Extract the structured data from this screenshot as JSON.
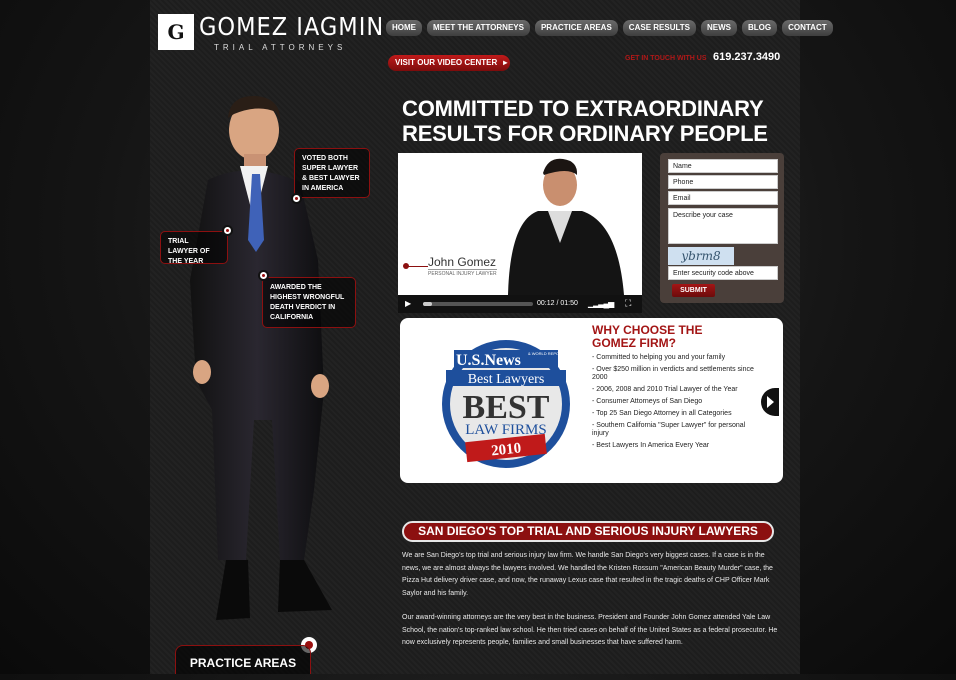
{
  "logo": {
    "mark": "G",
    "name": "GOMEZ IAGMIN",
    "tagline": "TRIAL ATTORNEYS"
  },
  "nav": [
    "HOME",
    "MEET THE ATTORNEYS",
    "PRACTICE AREAS",
    "CASE RESULTS",
    "NEWS",
    "BLOG",
    "CONTACT"
  ],
  "video_center": "VISIT OUR VIDEO CENTER",
  "get_in_touch": "GET IN TOUCH WITH US",
  "phone": "619.237.3490",
  "callouts": {
    "c1": "VOTED BOTH SUPER LAWYER & BEST LAWYER IN AMERICA",
    "c2": "TRIAL LAWYER OF THE YEAR",
    "c3": "AWARDED THE HIGHEST WRONGFUL DEATH VERDICT IN CALIFORNIA"
  },
  "headline": {
    "line1": "COMMITTED TO EXTRAORDINARY",
    "line2": "RESULTS FOR ORDINARY PEOPLE"
  },
  "video": {
    "name": "John Gomez",
    "title": "PERSONAL INJURY LAWYER",
    "time": "00:12 / 01:50",
    "progress": 0.08
  },
  "form": {
    "name": "Name",
    "phone": "Phone",
    "email": "Email",
    "describe": "Describe your case",
    "captcha": "ybrm8",
    "security": "Enter security code above",
    "submit": "SUBMIT"
  },
  "badge": {
    "top": "U.S.News",
    "small": "& WORLD REPORT",
    "best_lawyers": "Best Lawyers",
    "best": "BEST",
    "law_firms": "LAW FIRMS",
    "year": "2010"
  },
  "why": {
    "title1": "WHY CHOOSE THE",
    "title2": "GOMEZ FIRM?",
    "items": [
      "Committed to helping you and your family",
      "Over $250 million in verdicts and settlements since 2000",
      "2006, 2008 and 2010 Trial Lawyer of the Year",
      "Consumer Attorneys of San Diego",
      "Top 25 San Diego Attorney in all Categories",
      "Southern California \"Super Lawyer\" for personal injury",
      "Best Lawyers In America Every Year"
    ]
  },
  "section_title": "SAN DIEGO'S TOP TRIAL AND SERIOUS INJURY LAWYERS",
  "paragraphs": [
    "We are San Diego's top trial and serious injury law firm.  We handle San Diego's very biggest cases.  If a case is in the news, we are almost always the lawyers involved.  We handled the Kristen Rossum \"American Beauty Murder\" case, the Pizza Hut delivery driver case, and now, the runaway Lexus case that resulted in the tragic deaths of CHP Officer Mark Saylor and his family.",
    "Our award-winning attorneys are the very best in the business.  President and Founder John Gomez attended Yale Law School, the nation's top-ranked law school.  He then tried cases on behalf of the United States as a federal prosecutor.  He now exclusively represents people,  families and small businesses that have suffered harm."
  ],
  "practice_areas": "PRACTICE AREAS",
  "colors": {
    "accent": "#8c1010",
    "nav": "#4f4f4f",
    "form_bg": "#4a3f3a"
  }
}
